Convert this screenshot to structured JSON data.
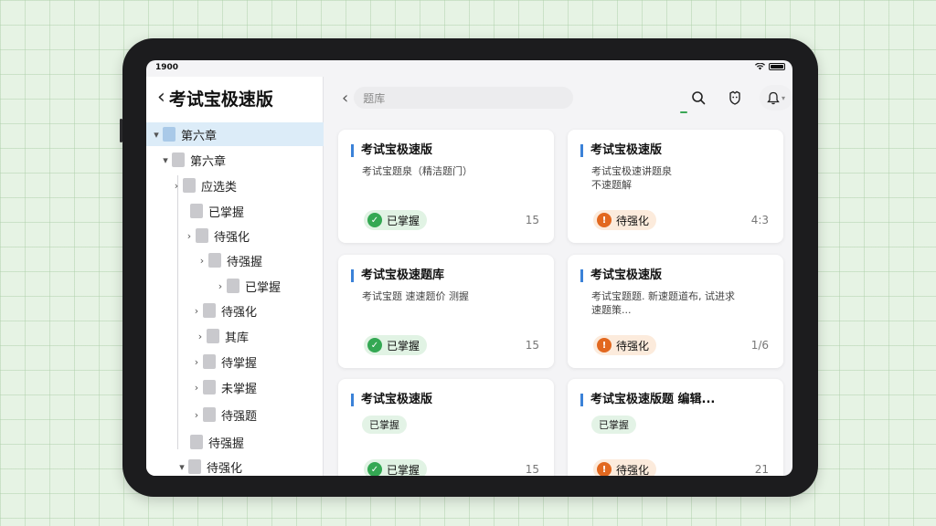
{
  "status": {
    "time": "1900"
  },
  "sidebar": {
    "back_icon": "chevron-left-icon",
    "title": "考试宝极速版",
    "tree": [
      {
        "label": "第六章",
        "twisty": "▾",
        "selected": true
      },
      {
        "label": "第六章",
        "twisty": "▾"
      },
      {
        "label": "应选类",
        "twisty": "›"
      },
      {
        "label": "已掌握",
        "twisty": ""
      },
      {
        "label": "待强化",
        "twisty": "›"
      },
      {
        "label": "待强握",
        "twisty": "›"
      },
      {
        "label": "已掌握",
        "twisty": "›"
      },
      {
        "label": "待强化",
        "twisty": "›"
      },
      {
        "label": "其库",
        "twisty": "›"
      },
      {
        "label": "待掌握",
        "twisty": "›"
      },
      {
        "label": "未掌握",
        "twisty": "›"
      },
      {
        "label": "待强题",
        "twisty": "›"
      },
      {
        "label": "待强握",
        "twisty": ""
      },
      {
        "label": "待强化",
        "twisty": "▾"
      }
    ]
  },
  "topbar": {
    "back_icon": "chevron-left-icon",
    "search_placeholder": "题库",
    "icons": [
      "search-icon",
      "shield-icon",
      "bell-icon",
      "chevron-down-icon"
    ]
  },
  "colors": {
    "accent_green": "#34a853",
    "accent_orange": "#e2681f",
    "title_bar_blue": "#3b82d8"
  },
  "cards": [
    {
      "title": "考试宝极速版",
      "desc": "考试宝题泉（精洁题门）",
      "chip": "",
      "status": "已掌握",
      "status_type": "green",
      "count": "15"
    },
    {
      "title": "考试宝极速版",
      "desc": "考试宝极速讲题泉\n不速题解",
      "chip": "",
      "status": "待强化",
      "status_type": "orange",
      "count": "4:3"
    },
    {
      "title": "考试宝极速题库",
      "desc": "考试宝题 速速题价 测握",
      "chip": "",
      "status": "已掌握",
      "status_type": "green",
      "count": "15"
    },
    {
      "title": "考试宝极速版",
      "desc": "考试宝题题. 新速题道布, 试进求\n速题策...",
      "chip": "",
      "status": "待强化",
      "status_type": "orange",
      "count": "1/6"
    },
    {
      "title": "考试宝极速版",
      "desc": "",
      "chip": "已掌握",
      "status": "已掌握",
      "status_type": "green",
      "count": "15"
    },
    {
      "title": "考试宝极速版题 编辑...",
      "desc": "",
      "chip": "已掌握",
      "status": "待强化",
      "status_type": "orange",
      "count": "21"
    }
  ]
}
